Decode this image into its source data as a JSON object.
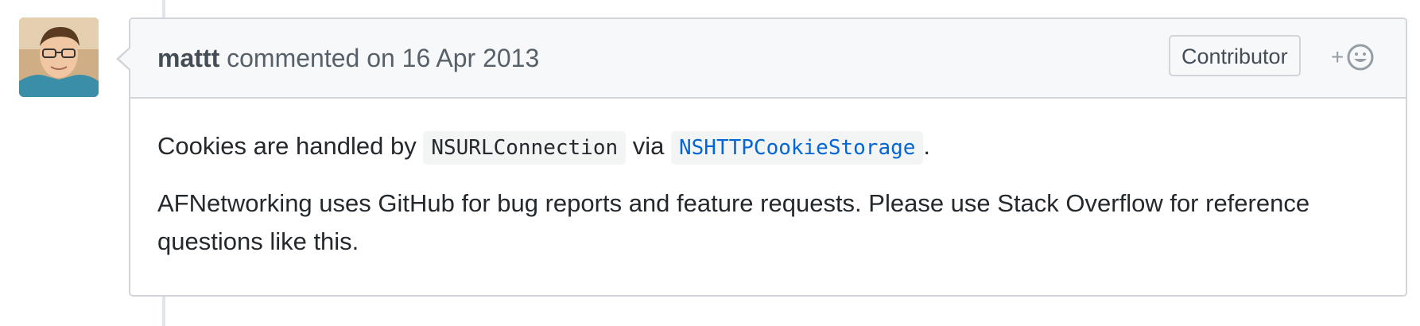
{
  "comment": {
    "author": "mattt",
    "action": "commented on",
    "date": "16 Apr 2013",
    "badge": "Contributor",
    "reaction_plus": "+",
    "reaction_icon": "smiley-icon",
    "body": {
      "p1_before": "Cookies are handled by ",
      "p1_code1": "NSURLConnection",
      "p1_mid": " via ",
      "p1_code2_link": "NSHTTPCookieStorage",
      "p1_after": ".",
      "p2": "AFNetworking uses GitHub for bug reports and feature requests. Please use Stack Overflow for reference questions like this."
    }
  },
  "colors": {
    "border": "#d1d5da",
    "header_bg": "#f6f8fa",
    "link": "#0366d6"
  }
}
